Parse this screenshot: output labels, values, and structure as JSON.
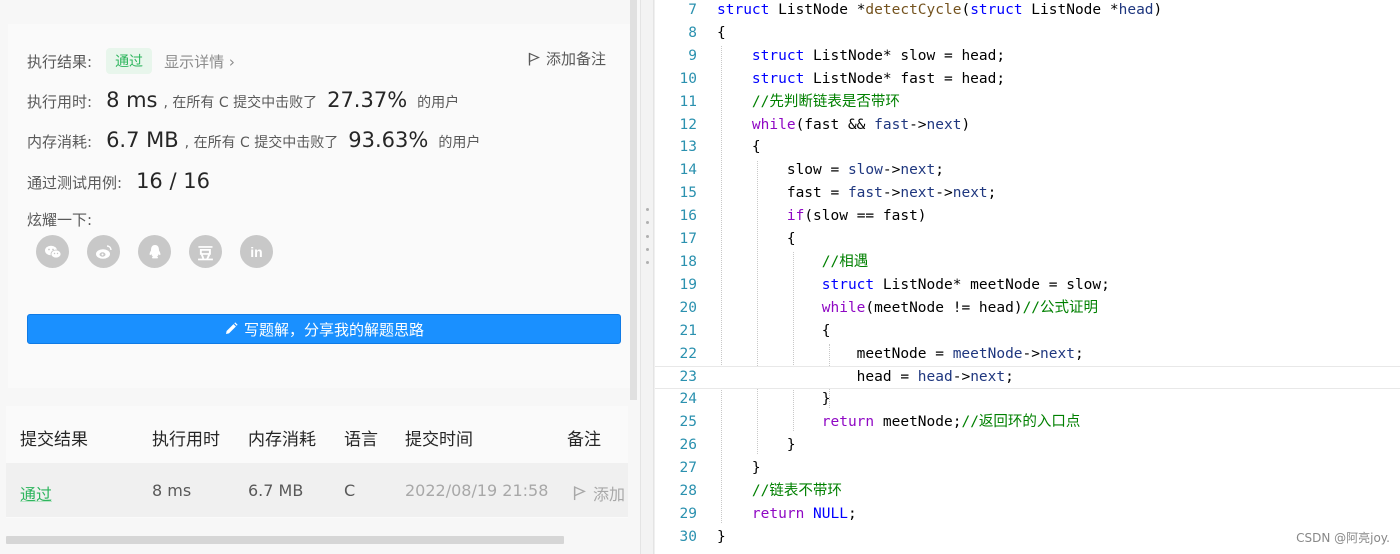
{
  "result": {
    "status_label": "执行结果:",
    "status_value": "通过",
    "detail_link": "显示详情 ›",
    "add_note": "添加备注",
    "runtime_label": "执行用时:",
    "runtime_value": "8 ms",
    "runtime_text": ", 在所有 C 提交中击败了",
    "runtime_percent": "27.37%",
    "runtime_suffix": "的用户",
    "memory_label": "内存消耗:",
    "memory_value": "6.7 MB",
    "memory_text": ", 在所有 C 提交中击败了",
    "memory_percent": "93.63%",
    "memory_suffix": "的用户",
    "tests_label": "通过测试用例:",
    "tests_value": "16 / 16",
    "share_label": "炫耀一下:",
    "share_icons": [
      "wechat-icon",
      "weibo-icon",
      "qq-icon",
      "douban-icon",
      "linkedin-icon"
    ],
    "douban_glyph": "豆",
    "linkedin_glyph": "in",
    "solution_button": "写题解，分享我的解题思路"
  },
  "submissions": {
    "headers": [
      "提交结果",
      "执行用时",
      "内存消耗",
      "语言",
      "提交时间",
      "备注"
    ],
    "rows": [
      {
        "result": "通过",
        "runtime": "8 ms",
        "memory": "6.7 MB",
        "language": "C",
        "time": "2022/08/19 21:58",
        "note": "添加"
      }
    ]
  },
  "code": {
    "lines": [
      {
        "no": "7",
        "html": "<span class=\"kw\">struct</span> ListNode *<span class=\"fn\">detectCycle</span>(<span class=\"kw\">struct</span> ListNode *<span class=\"var\">head</span>)"
      },
      {
        "no": "8",
        "html": "{"
      },
      {
        "no": "9",
        "html": "    <span class=\"kw\">struct</span> ListNode* slow = head;"
      },
      {
        "no": "10",
        "html": "    <span class=\"kw\">struct</span> ListNode* fast = head;"
      },
      {
        "no": "11",
        "html": "    <span class=\"cmt\">//先判断链表是否带环</span>"
      },
      {
        "no": "12",
        "html": "    <span class=\"ctrl\">while</span>(fast &amp;&amp; <span class=\"var\">fast</span>-&gt;<span class=\"var\">next</span>)"
      },
      {
        "no": "13",
        "html": "    {"
      },
      {
        "no": "14",
        "html": "        slow = <span class=\"var\">slow</span>-&gt;<span class=\"var\">next</span>;"
      },
      {
        "no": "15",
        "html": "        fast = <span class=\"var\">fast</span>-&gt;<span class=\"var\">next</span>-&gt;<span class=\"var\">next</span>;"
      },
      {
        "no": "16",
        "html": "        <span class=\"ctrl\">if</span>(slow == fast)"
      },
      {
        "no": "17",
        "html": "        {"
      },
      {
        "no": "18",
        "html": "            <span class=\"cmt\">//相遇</span>"
      },
      {
        "no": "19",
        "html": "            <span class=\"kw\">struct</span> ListNode* meetNode = slow;"
      },
      {
        "no": "20",
        "html": "            <span class=\"ctrl\">while</span>(meetNode != head)<span class=\"cmt\">//公式证明</span>"
      },
      {
        "no": "21",
        "html": "            {"
      },
      {
        "no": "22",
        "html": "                meetNode = <span class=\"var\">meetNode</span>-&gt;<span class=\"var\">next</span>;"
      },
      {
        "no": "23",
        "html": "                head = <span class=\"var\">head</span>-&gt;<span class=\"var\">next</span>;"
      },
      {
        "no": "24",
        "html": "            }"
      },
      {
        "no": "25",
        "html": "            <span class=\"ctrl\">return</span> meetNode;<span class=\"cmt\">//返回环的入口点</span>"
      },
      {
        "no": "26",
        "html": "        }"
      },
      {
        "no": "27",
        "html": "    }"
      },
      {
        "no": "28",
        "html": "    <span class=\"cmt\">//链表不带环</span>"
      },
      {
        "no": "29",
        "html": "    <span class=\"ctrl\">return</span> <span class=\"kw\">NULL</span>;"
      },
      {
        "no": "30",
        "html": "}"
      }
    ],
    "current_line": "23"
  },
  "watermark": "CSDN @阿亮joy."
}
